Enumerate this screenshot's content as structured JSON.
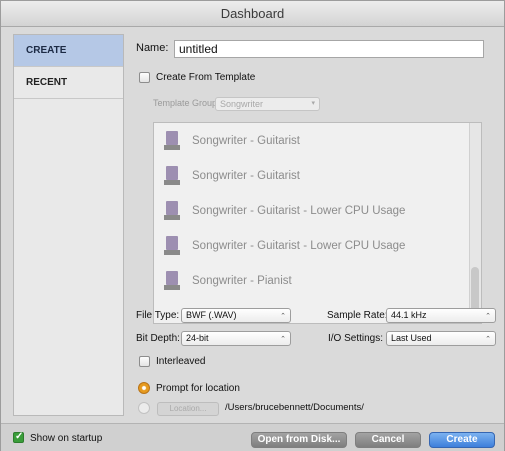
{
  "window": {
    "title": "Dashboard"
  },
  "sidebar": {
    "items": [
      {
        "label": "CREATE"
      },
      {
        "label": "RECENT"
      }
    ]
  },
  "form": {
    "name_label": "Name:",
    "name_value": "untitled",
    "create_from_template_label": "Create From Template",
    "template_group_label": "Template Group:",
    "template_group_value": "Songwriter",
    "templates": [
      {
        "label": "Songwriter - Guitarist"
      },
      {
        "label": "Songwriter - Guitarist"
      },
      {
        "label": "Songwriter - Guitarist - Lower CPU Usage"
      },
      {
        "label": "Songwriter - Guitarist - Lower CPU Usage"
      },
      {
        "label": "Songwriter - Pianist"
      }
    ],
    "file_type_label": "File Type:",
    "file_type_value": "BWF (.WAV)",
    "sample_rate_label": "Sample Rate:",
    "sample_rate_value": "44.1 kHz",
    "bit_depth_label": "Bit Depth:",
    "bit_depth_value": "24-bit",
    "io_settings_label": "I/O Settings:",
    "io_settings_value": "Last Used",
    "interleaved_label": "Interleaved",
    "prompt_location_label": "Prompt for location",
    "location_path": "/Users/brucebennett/Documents/",
    "choose_label": "Location..."
  },
  "footer": {
    "show_on_startup_label": "Show on startup",
    "open_from_disk_label": "Open from Disk...",
    "cancel_label": "Cancel",
    "create_label": "Create"
  },
  "colors": {
    "accent": "#3d7fdb",
    "sidebar_active": "#b5c8e6",
    "radio_on": "#e69a1e",
    "checkbox_on": "#3a9d3a"
  }
}
